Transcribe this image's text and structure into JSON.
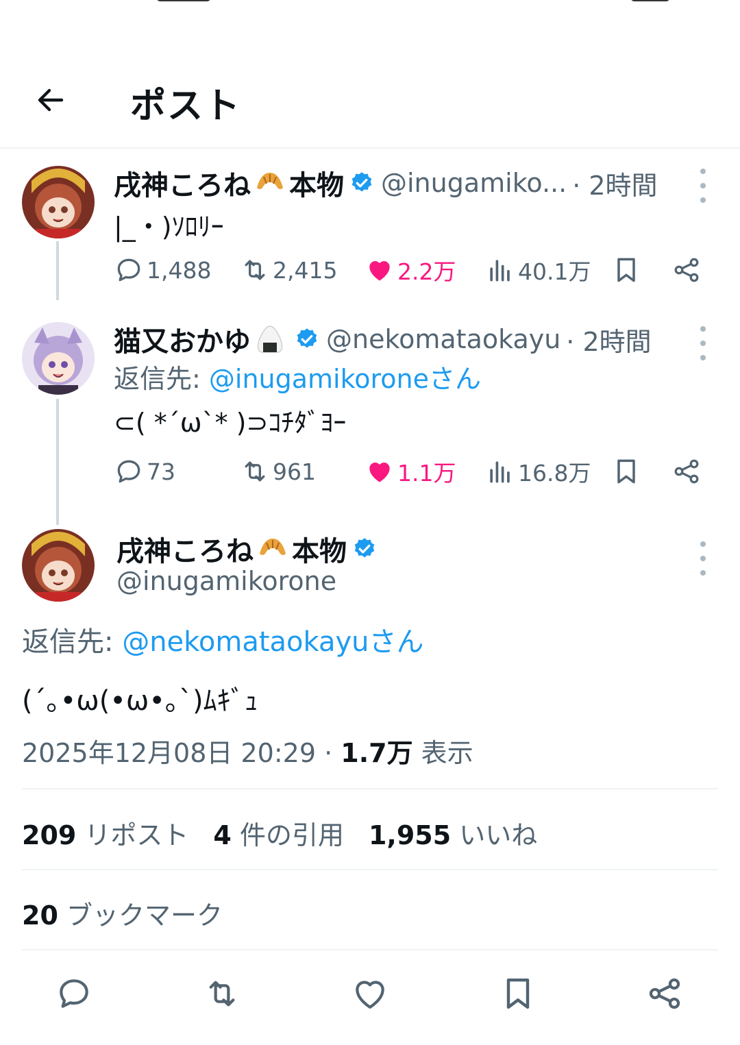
{
  "header": {
    "title": "ポスト"
  },
  "thread": [
    {
      "display_name": "戌神ころね",
      "name_suffix": "本物",
      "name_emoji": "croissant-emoji",
      "handle": "@inugamiko...",
      "time": "· 2時間",
      "text": "|_・)ｿﾛﾘｰ",
      "stats": {
        "replies": "1,488",
        "reposts": "2,415",
        "likes": "2.2万",
        "views": "40.1万"
      }
    },
    {
      "display_name": "猫又おかゆ",
      "name_emoji": "onigiri-emoji",
      "handle": "@nekomataokayu",
      "time": "· 2時間",
      "reply_prefix": "返信先: ",
      "reply_mention": "@inugamikoroneさん",
      "text": "⊂( *´ω`* )⊃ｺﾁﾀﾞﾖｰ",
      "stats": {
        "replies": "73",
        "reposts": "961",
        "likes": "1.1万",
        "views": "16.8万"
      }
    }
  ],
  "main_post": {
    "display_name": "戌神ころね",
    "name_suffix": "本物",
    "name_emoji": "croissant-emoji",
    "handle": "@inugamikorone",
    "reply_prefix": "返信先: ",
    "reply_mention": "@nekomataokayuさん",
    "text": "(´｡•ω(•ω•｡`)ﾑｷﾞｭ",
    "timestamp": "2025年12月08日 20:29",
    "sep": " · ",
    "views_count": "1.7万",
    "views_label": " 表示",
    "reposts_count": "209",
    "reposts_label": " リポスト",
    "quotes_count": "4",
    "quotes_label": " 件の引用",
    "likes_count": "1,955",
    "likes_label": " いいね",
    "bookmarks_count": "20",
    "bookmarks_label": " ブックマーク"
  },
  "colors": {
    "accent": "#1d9bf0",
    "like": "#f91880",
    "muted": "#536471",
    "text": "#0f1419",
    "divider": "#eff3f4"
  }
}
